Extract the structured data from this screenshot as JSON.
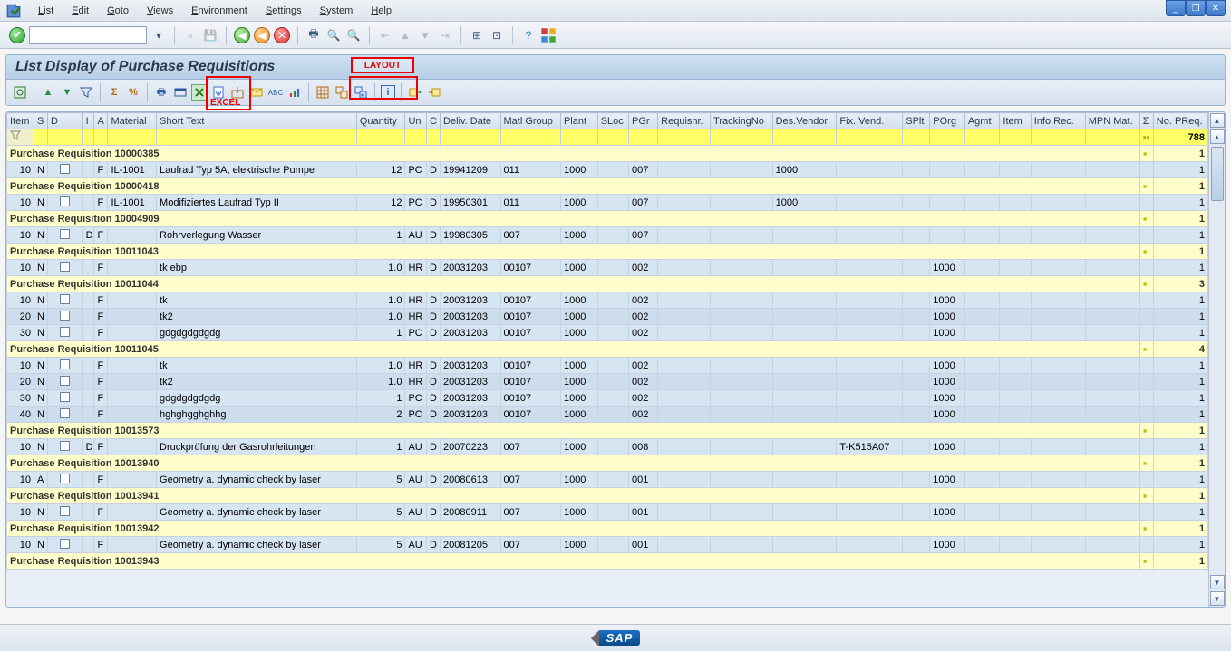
{
  "menu": {
    "items": [
      "List",
      "Edit",
      "Goto",
      "Views",
      "Environment",
      "Settings",
      "System",
      "Help"
    ]
  },
  "app_title": "List Display of Purchase Requisitions",
  "annotations": {
    "layout": "LAYOUT",
    "excel": "EXCEL"
  },
  "footer_logo": "SAP",
  "totals_row": {
    "sigma": "▪▪",
    "no_preq": "788"
  },
  "columns": [
    "Item",
    "S",
    "D",
    "I",
    "A",
    "Material",
    "Short Text",
    "Quantity",
    "Un",
    "C",
    "Deliv. Date",
    "Matl Group",
    "Plant",
    "SLoc",
    "PGr",
    "Requisnr.",
    "TrackingNo",
    "Des.Vendor",
    "Fix. Vend.",
    "SPlt",
    "POrg",
    "Agmt",
    "Item",
    "Info Rec.",
    "MPN Mat.",
    "Σ",
    "No. PReq."
  ],
  "groups": [
    {
      "title": "Purchase Requisition 10000385",
      "count": "1",
      "rows": [
        {
          "item": "10",
          "s": "N",
          "a": "F",
          "mat": "IL-1001",
          "txt": "Laufrad Typ 5A, elektrische Pumpe",
          "qty": "12",
          "un": "PC",
          "c": "D",
          "dd": "19941209",
          "mg": "011",
          "pl": "1000",
          "pg": "007",
          "dv": "1000",
          "np": "1"
        }
      ]
    },
    {
      "title": "Purchase Requisition 10000418",
      "count": "1",
      "rows": [
        {
          "item": "10",
          "s": "N",
          "a": "F",
          "mat": "IL-1001",
          "txt": "Modifiziertes Laufrad Typ II",
          "qty": "12",
          "un": "PC",
          "c": "D",
          "dd": "19950301",
          "mg": "011",
          "pl": "1000",
          "pg": "007",
          "dv": "1000",
          "np": "1"
        }
      ]
    },
    {
      "title": "Purchase Requisition 10004909",
      "count": "1",
      "rows": [
        {
          "item": "10",
          "s": "N",
          "i": "D",
          "a": "F",
          "txt": "Rohrverlegung Wasser",
          "qty": "1",
          "un": "AU",
          "c": "D",
          "dd": "19980305",
          "mg": "007",
          "pl": "1000",
          "pg": "007",
          "np": "1"
        }
      ]
    },
    {
      "title": "Purchase Requisition 10011043",
      "count": "1",
      "rows": [
        {
          "item": "10",
          "s": "N",
          "a": "F",
          "txt": "tk ebp",
          "qty": "1.0",
          "un": "HR",
          "c": "D",
          "dd": "20031203",
          "mg": "00107",
          "pl": "1000",
          "pg": "002",
          "po": "1000",
          "np": "1"
        }
      ]
    },
    {
      "title": "Purchase Requisition 10011044",
      "count": "3",
      "rows": [
        {
          "item": "10",
          "s": "N",
          "a": "F",
          "txt": "tk",
          "qty": "1.0",
          "un": "HR",
          "c": "D",
          "dd": "20031203",
          "mg": "00107",
          "pl": "1000",
          "pg": "002",
          "po": "1000",
          "np": "1"
        },
        {
          "item": "20",
          "s": "N",
          "a": "F",
          "txt": "tk2",
          "qty": "1.0",
          "un": "HR",
          "c": "D",
          "dd": "20031203",
          "mg": "00107",
          "pl": "1000",
          "pg": "002",
          "po": "1000",
          "np": "1"
        },
        {
          "item": "30",
          "s": "N",
          "a": "F",
          "txt": "gdgdgdgdgdg",
          "qty": "1",
          "un": "PC",
          "c": "D",
          "dd": "20031203",
          "mg": "00107",
          "pl": "1000",
          "pg": "002",
          "po": "1000",
          "np": "1"
        }
      ]
    },
    {
      "title": "Purchase Requisition 10011045",
      "count": "4",
      "rows": [
        {
          "item": "10",
          "s": "N",
          "a": "F",
          "txt": "tk",
          "qty": "1.0",
          "un": "HR",
          "c": "D",
          "dd": "20031203",
          "mg": "00107",
          "pl": "1000",
          "pg": "002",
          "po": "1000",
          "np": "1"
        },
        {
          "item": "20",
          "s": "N",
          "a": "F",
          "txt": "tk2",
          "qty": "1.0",
          "un": "HR",
          "c": "D",
          "dd": "20031203",
          "mg": "00107",
          "pl": "1000",
          "pg": "002",
          "po": "1000",
          "np": "1"
        },
        {
          "item": "30",
          "s": "N",
          "a": "F",
          "txt": "gdgdgdgdgdg",
          "qty": "1",
          "un": "PC",
          "c": "D",
          "dd": "20031203",
          "mg": "00107",
          "pl": "1000",
          "pg": "002",
          "po": "1000",
          "np": "1"
        },
        {
          "item": "40",
          "s": "N",
          "a": "F",
          "txt": "hghghgghghhg",
          "qty": "2",
          "un": "PC",
          "c": "D",
          "dd": "20031203",
          "mg": "00107",
          "pl": "1000",
          "pg": "002",
          "po": "1000",
          "np": "1"
        }
      ]
    },
    {
      "title": "Purchase Requisition 10013573",
      "count": "1",
      "rows": [
        {
          "item": "10",
          "s": "N",
          "i": "D",
          "a": "F",
          "txt": "Druckprüfung der Gasrohrleitungen",
          "qty": "1",
          "un": "AU",
          "c": "D",
          "dd": "20070223",
          "mg": "007",
          "pl": "1000",
          "pg": "008",
          "fv": "T-K515A07",
          "po": "1000",
          "np": "1"
        }
      ]
    },
    {
      "title": "Purchase Requisition 10013940",
      "count": "1",
      "rows": [
        {
          "item": "10",
          "s": "A",
          "a": "F",
          "txt": "Geometry a. dynamic check by laser",
          "qty": "5",
          "un": "AU",
          "c": "D",
          "dd": "20080613",
          "mg": "007",
          "pl": "1000",
          "pg": "001",
          "po": "1000",
          "np": "1"
        }
      ]
    },
    {
      "title": "Purchase Requisition 10013941",
      "count": "1",
      "rows": [
        {
          "item": "10",
          "s": "N",
          "a": "F",
          "txt": "Geometry a. dynamic check by laser",
          "qty": "5",
          "un": "AU",
          "c": "D",
          "dd": "20080911",
          "mg": "007",
          "pl": "1000",
          "pg": "001",
          "po": "1000",
          "np": "1"
        }
      ]
    },
    {
      "title": "Purchase Requisition 10013942",
      "count": "1",
      "rows": [
        {
          "item": "10",
          "s": "N",
          "a": "F",
          "txt": "Geometry a. dynamic check by laser",
          "qty": "5",
          "un": "AU",
          "c": "D",
          "dd": "20081205",
          "mg": "007",
          "pl": "1000",
          "pg": "001",
          "po": "1000",
          "np": "1"
        }
      ]
    },
    {
      "title": "Purchase Requisition 10013943",
      "count": "1",
      "rows": []
    }
  ]
}
